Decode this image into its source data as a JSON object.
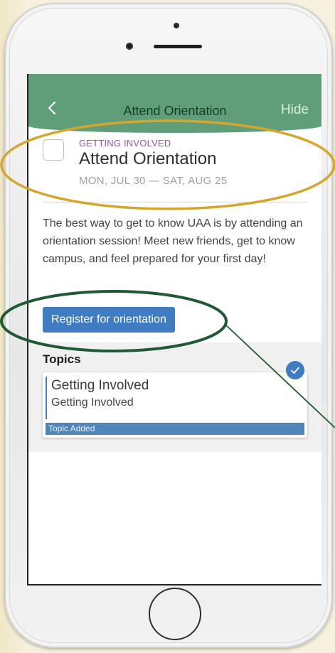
{
  "app_bar": {
    "title": "Attend Orientation",
    "hide_label": "Hide"
  },
  "task": {
    "category": "GETTING INVOLVED",
    "title": "Attend Orientation",
    "dates": "MON, JUL 30 — SAT, AUG 25",
    "checked": false
  },
  "description": "The best way to get to know UAA is by attending an orientation session! Meet new friends, get to know campus, and feel prepared for your first day!",
  "register_button_label": "Register for orientation",
  "topics": {
    "heading": "Topics",
    "items": [
      {
        "title": "Getting Involved",
        "subtitle": "Getting Involved",
        "badge": "Topic Added",
        "added": true
      }
    ]
  },
  "colors": {
    "app_bar": "#5f9e78",
    "category_text": "#8e52b8",
    "primary_button": "#3f7cc2",
    "highlight_gold": "#d4a72c",
    "highlight_green": "#1f5a35"
  },
  "icons": {
    "back": "chevron-left-icon",
    "check": "checkmark-icon"
  }
}
